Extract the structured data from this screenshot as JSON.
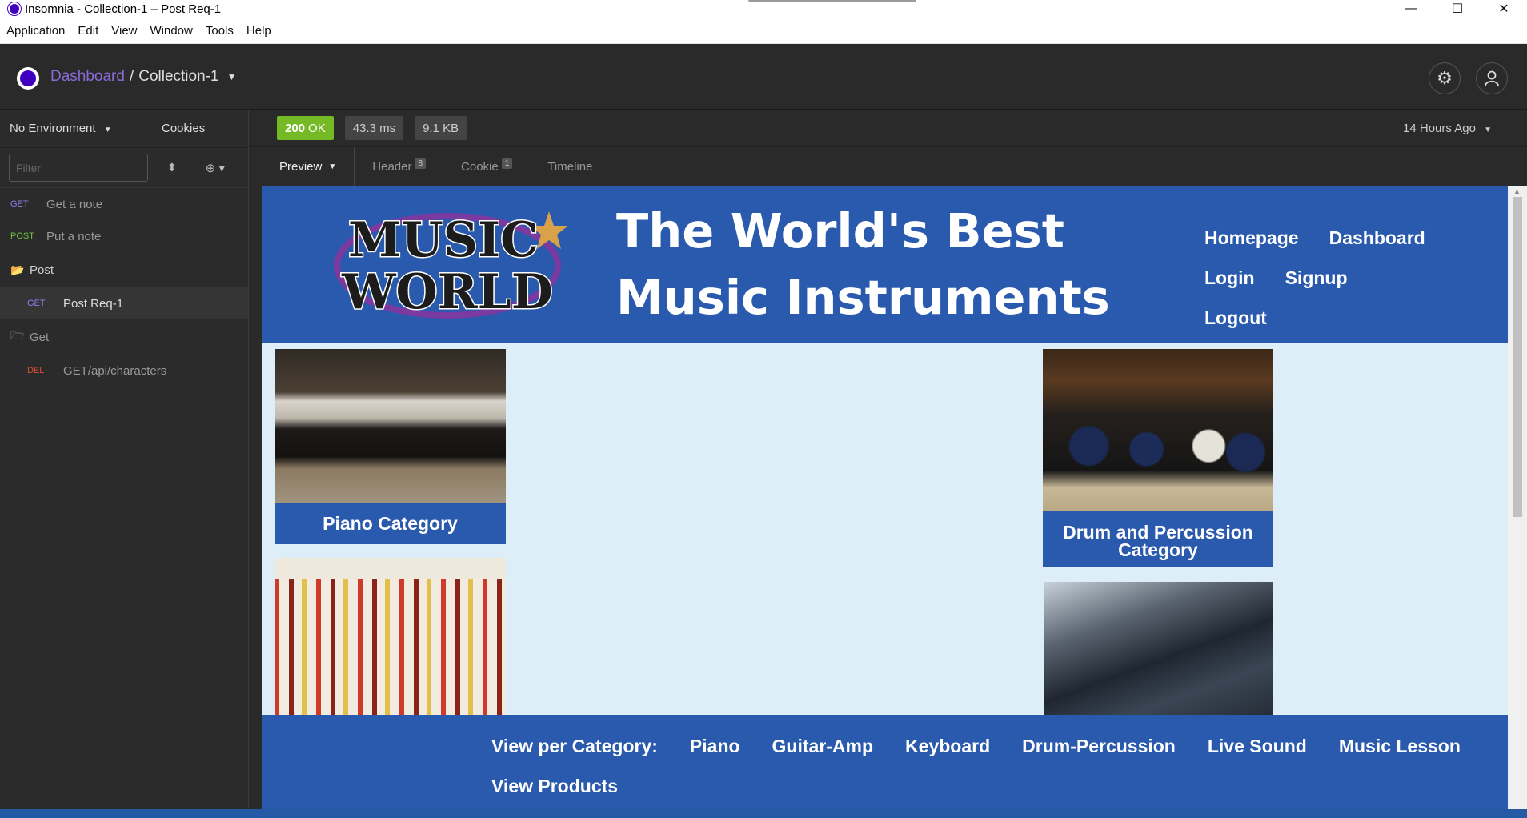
{
  "window": {
    "title": "Insomnia - Collection-1 – Post Req-1",
    "controls": [
      "—",
      "☐",
      "✕"
    ]
  },
  "menu": [
    "Application",
    "Edit",
    "View",
    "Window",
    "Tools",
    "Help"
  ],
  "header": {
    "dashboard": "Dashboard",
    "separator": "/",
    "collection": "Collection-1"
  },
  "sidebar": {
    "environment": "No Environment",
    "cookies": "Cookies",
    "filter_placeholder": "Filter",
    "items": [
      {
        "method": "GET",
        "label": "Get a note"
      },
      {
        "method": "POST",
        "label": "Put a note"
      }
    ],
    "folders": [
      {
        "label": "Post",
        "items": [
          {
            "method": "GET",
            "label": "Post Req-1"
          }
        ]
      },
      {
        "label": "Get",
        "items": [
          {
            "method": "DEL",
            "label": "GET/api/characters"
          }
        ]
      }
    ]
  },
  "response": {
    "status_code": "200",
    "status_text": "OK",
    "time": "43.3 ms",
    "size": "9.1 KB",
    "time_ago": "14 Hours Ago",
    "tabs": [
      {
        "label": "Preview"
      },
      {
        "label": "Header",
        "count": "8"
      },
      {
        "label": "Cookie",
        "count": "1"
      },
      {
        "label": "Timeline"
      }
    ]
  },
  "site": {
    "logo": {
      "line1": "MUSIC",
      "line2": "WORLD"
    },
    "headline": {
      "line1": "The World's Best",
      "line2": "Music Instruments"
    },
    "nav": [
      "Homepage",
      "Dashboard",
      "Login",
      "Signup",
      "Logout"
    ],
    "cards": {
      "piano": "Piano Category",
      "drum_line1": "Drum and Percussion",
      "drum_line2": "Category"
    },
    "footer": {
      "label": "View per Category:",
      "links": [
        "Piano",
        "Guitar-Amp",
        "Keyboard",
        "Drum-Percussion",
        "Live Sound",
        "Music Lesson"
      ],
      "view_products": "View Products"
    }
  },
  "colors": {
    "accent": "#4000bf",
    "ok": "#75ba24",
    "site_blue": "#2a5aad",
    "site_bg": "#ddeef9"
  }
}
